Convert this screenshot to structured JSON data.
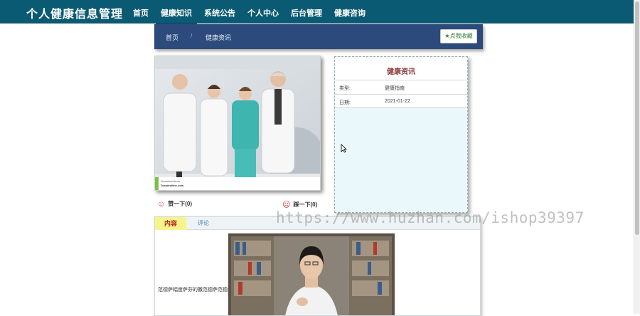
{
  "app": {
    "title": "个人健康信息管理"
  },
  "nav": {
    "items": [
      {
        "label": "首页",
        "active": false
      },
      {
        "label": "健康知识",
        "active": true
      },
      {
        "label": "系统公告",
        "active": false
      },
      {
        "label": "个人中心",
        "active": false
      },
      {
        "label": "后台管理",
        "active": false
      },
      {
        "label": "健康咨询",
        "active": false
      }
    ]
  },
  "breadcrumb": {
    "home": "首页",
    "separator": "/",
    "current": "健康资讯"
  },
  "favorite_button": {
    "icon": "star-icon",
    "label": "点我收藏"
  },
  "image_card": {
    "caption_source": "Download from",
    "caption_site": "Dreamstime.com"
  },
  "votes": {
    "up": {
      "icon": "smile-icon",
      "label": "赞一下(0)"
    },
    "down": {
      "icon": "frown-icon",
      "label": "踩一下(0)"
    }
  },
  "info": {
    "title": "健康资讯",
    "rows": [
      {
        "key": "类型:",
        "value": "健康指南"
      },
      {
        "key": "日期:",
        "value": "2021-01-22"
      }
    ]
  },
  "tabs": [
    {
      "label": "内容",
      "active": true
    },
    {
      "label": "评论",
      "active": false
    }
  ],
  "content": {
    "text": "范德萨幅度萨芬的撒范德萨范德萨"
  },
  "watermark": "https://www.huzhan.com/ishop39397",
  "colors": {
    "topbar": "#0b5a73",
    "crumbbar": "#2c4a7c",
    "info_bg": "#eaf8fb",
    "active_tab": "#f7f58a",
    "vote_icon": "#d32f2f"
  }
}
